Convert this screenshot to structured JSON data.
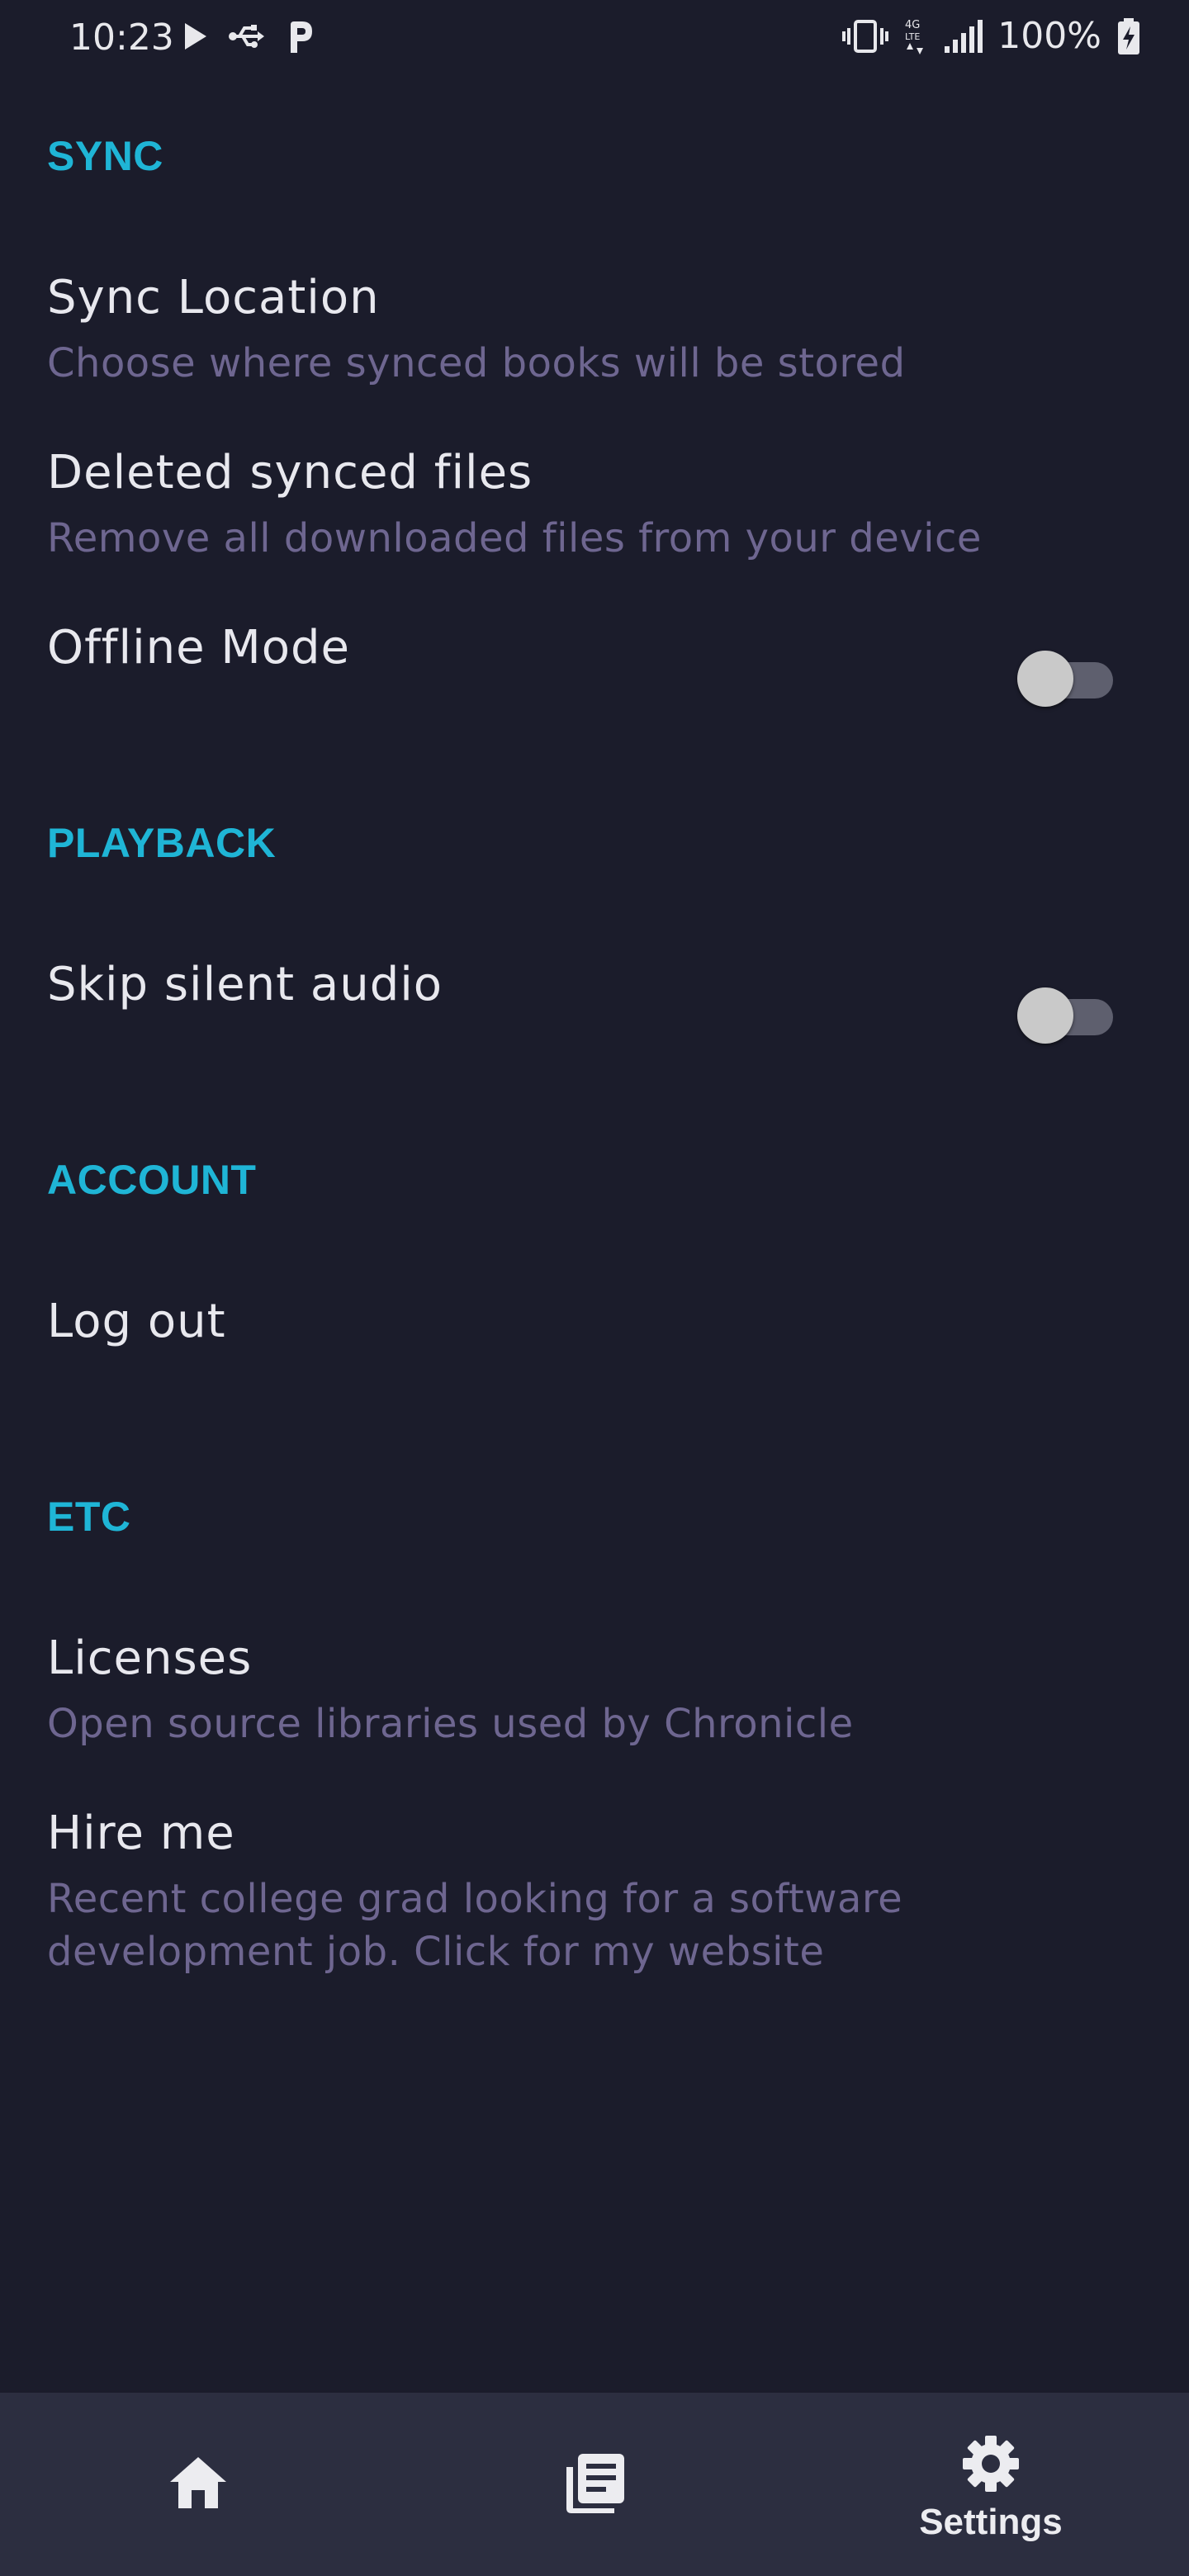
{
  "status_bar": {
    "time": "10:23",
    "battery": "100%",
    "left_icons": [
      "play-icon",
      "usb-icon",
      "parking-icon"
    ],
    "right_icons": [
      "vibrate-icon",
      "lte-icon",
      "signal-icon",
      "battery-charging-icon"
    ]
  },
  "sections": {
    "sync": {
      "header": "SYNC",
      "sync_location": {
        "title": "Sync Location",
        "summary": "Choose where synced books will be stored"
      },
      "delete_synced": {
        "title": "Deleted synced files",
        "summary": "Remove all downloaded files from your device"
      },
      "offline_mode": {
        "title": "Offline Mode",
        "enabled": false
      }
    },
    "playback": {
      "header": "PLAYBACK",
      "skip_silent": {
        "title": "Skip silent audio",
        "enabled": false
      }
    },
    "account": {
      "header": "ACCOUNT",
      "logout": {
        "title": "Log out"
      }
    },
    "etc": {
      "header": "ETC",
      "licenses": {
        "title": "Licenses",
        "summary": "Open source libraries used by Chronicle"
      },
      "hire_me": {
        "title": "Hire me",
        "summary_line1": "Recent college grad looking for a software",
        "summary_line2": "development job. Click for my website"
      }
    }
  },
  "bottom_nav": {
    "items": [
      {
        "icon": "home-icon",
        "label": ""
      },
      {
        "icon": "library-icon",
        "label": ""
      },
      {
        "icon": "gear-icon",
        "label": "Settings",
        "selected": true
      }
    ]
  },
  "colors": {
    "background": "#1b1c2b",
    "accent": "#1fb5d6",
    "summary": "#6e6690",
    "nav_background": "#2c2e40"
  }
}
